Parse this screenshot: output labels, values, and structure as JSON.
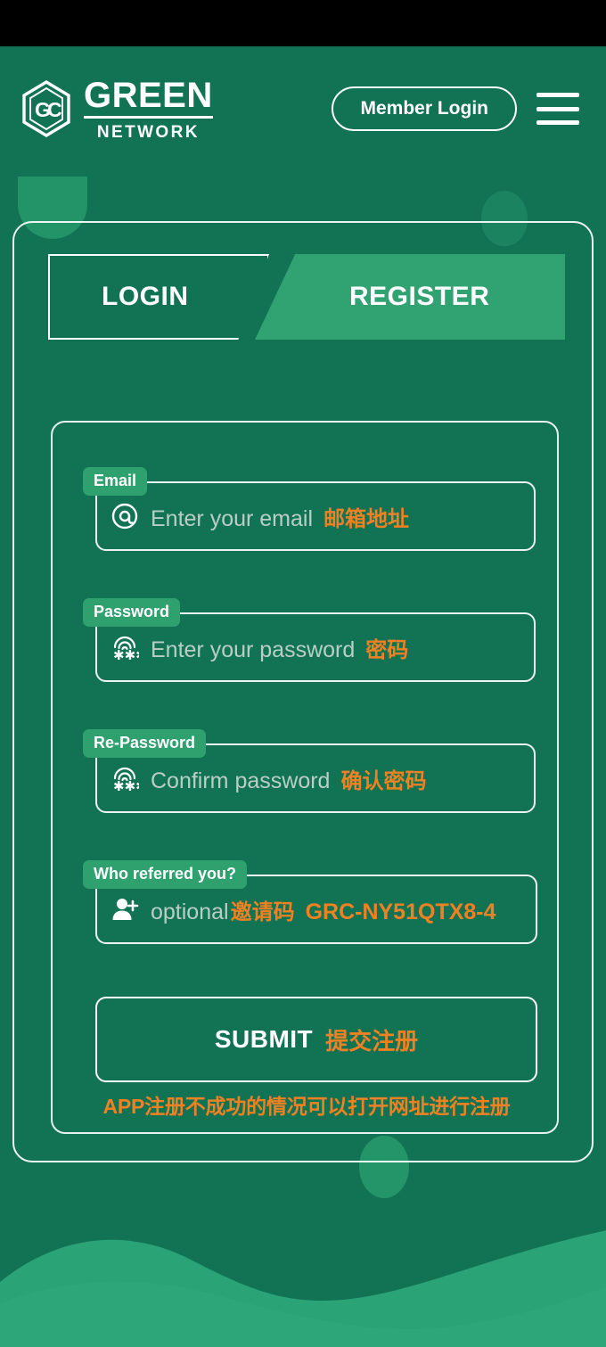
{
  "colors": {
    "background": "#127254",
    "accent_light_green": "#31a272",
    "orange": "#ef8122",
    "white": "#ffffff",
    "placeholder_gray": "#b9cfc5",
    "statusbar": "#000000"
  },
  "header": {
    "logo": {
      "monogram": "GC",
      "primary": "GREEN",
      "secondary": "NETWORK"
    },
    "member_login_label": "Member Login",
    "menu_icon": "hamburger-menu-icon"
  },
  "tabs": [
    {
      "id": "login",
      "label": "LOGIN",
      "active": false
    },
    {
      "id": "register",
      "label": "REGISTER",
      "active": true
    }
  ],
  "form": {
    "fields": [
      {
        "id": "email",
        "label": "Email",
        "icon": "at-sign-icon",
        "placeholder": "Enter your email",
        "hint_cn": "邮箱地址",
        "value": ""
      },
      {
        "id": "password",
        "label": "Password",
        "icon": "fingerprint-password-icon",
        "placeholder": "Enter your password",
        "hint_cn": "密码",
        "value": ""
      },
      {
        "id": "repassword",
        "label": "Re-Password",
        "icon": "fingerprint-password-icon",
        "placeholder": "Confirm password",
        "hint_cn": "确认密码",
        "value": ""
      },
      {
        "id": "referrer",
        "label": "Who referred you?",
        "icon": "add-person-icon",
        "placeholder": "optional",
        "hint_cn": "邀请码",
        "value": "GRC-NY51QTX8-4"
      }
    ],
    "submit": {
      "label_en": "SUBMIT",
      "label_cn": "提交注册"
    },
    "note": "APP注册不成功的情况可以打开网址进行注册"
  }
}
